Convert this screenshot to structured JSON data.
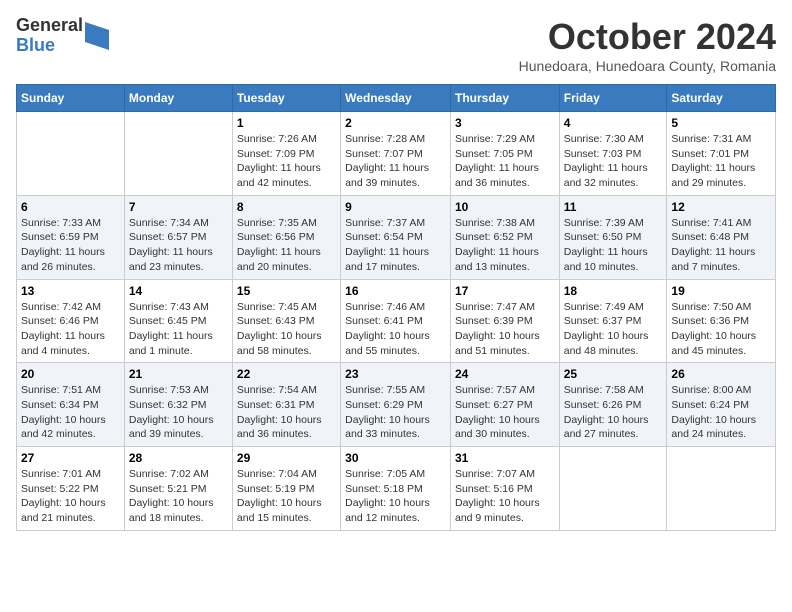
{
  "logo": {
    "line1": "General",
    "line2": "Blue"
  },
  "header": {
    "month": "October 2024",
    "location": "Hunedoara, Hunedoara County, Romania"
  },
  "weekdays": [
    "Sunday",
    "Monday",
    "Tuesday",
    "Wednesday",
    "Thursday",
    "Friday",
    "Saturday"
  ],
  "weeks": [
    [
      {
        "day": "",
        "info": ""
      },
      {
        "day": "",
        "info": ""
      },
      {
        "day": "1",
        "info": "Sunrise: 7:26 AM\nSunset: 7:09 PM\nDaylight: 11 hours and 42 minutes."
      },
      {
        "day": "2",
        "info": "Sunrise: 7:28 AM\nSunset: 7:07 PM\nDaylight: 11 hours and 39 minutes."
      },
      {
        "day": "3",
        "info": "Sunrise: 7:29 AM\nSunset: 7:05 PM\nDaylight: 11 hours and 36 minutes."
      },
      {
        "day": "4",
        "info": "Sunrise: 7:30 AM\nSunset: 7:03 PM\nDaylight: 11 hours and 32 minutes."
      },
      {
        "day": "5",
        "info": "Sunrise: 7:31 AM\nSunset: 7:01 PM\nDaylight: 11 hours and 29 minutes."
      }
    ],
    [
      {
        "day": "6",
        "info": "Sunrise: 7:33 AM\nSunset: 6:59 PM\nDaylight: 11 hours and 26 minutes."
      },
      {
        "day": "7",
        "info": "Sunrise: 7:34 AM\nSunset: 6:57 PM\nDaylight: 11 hours and 23 minutes."
      },
      {
        "day": "8",
        "info": "Sunrise: 7:35 AM\nSunset: 6:56 PM\nDaylight: 11 hours and 20 minutes."
      },
      {
        "day": "9",
        "info": "Sunrise: 7:37 AM\nSunset: 6:54 PM\nDaylight: 11 hours and 17 minutes."
      },
      {
        "day": "10",
        "info": "Sunrise: 7:38 AM\nSunset: 6:52 PM\nDaylight: 11 hours and 13 minutes."
      },
      {
        "day": "11",
        "info": "Sunrise: 7:39 AM\nSunset: 6:50 PM\nDaylight: 11 hours and 10 minutes."
      },
      {
        "day": "12",
        "info": "Sunrise: 7:41 AM\nSunset: 6:48 PM\nDaylight: 11 hours and 7 minutes."
      }
    ],
    [
      {
        "day": "13",
        "info": "Sunrise: 7:42 AM\nSunset: 6:46 PM\nDaylight: 11 hours and 4 minutes."
      },
      {
        "day": "14",
        "info": "Sunrise: 7:43 AM\nSunset: 6:45 PM\nDaylight: 11 hours and 1 minute."
      },
      {
        "day": "15",
        "info": "Sunrise: 7:45 AM\nSunset: 6:43 PM\nDaylight: 10 hours and 58 minutes."
      },
      {
        "day": "16",
        "info": "Sunrise: 7:46 AM\nSunset: 6:41 PM\nDaylight: 10 hours and 55 minutes."
      },
      {
        "day": "17",
        "info": "Sunrise: 7:47 AM\nSunset: 6:39 PM\nDaylight: 10 hours and 51 minutes."
      },
      {
        "day": "18",
        "info": "Sunrise: 7:49 AM\nSunset: 6:37 PM\nDaylight: 10 hours and 48 minutes."
      },
      {
        "day": "19",
        "info": "Sunrise: 7:50 AM\nSunset: 6:36 PM\nDaylight: 10 hours and 45 minutes."
      }
    ],
    [
      {
        "day": "20",
        "info": "Sunrise: 7:51 AM\nSunset: 6:34 PM\nDaylight: 10 hours and 42 minutes."
      },
      {
        "day": "21",
        "info": "Sunrise: 7:53 AM\nSunset: 6:32 PM\nDaylight: 10 hours and 39 minutes."
      },
      {
        "day": "22",
        "info": "Sunrise: 7:54 AM\nSunset: 6:31 PM\nDaylight: 10 hours and 36 minutes."
      },
      {
        "day": "23",
        "info": "Sunrise: 7:55 AM\nSunset: 6:29 PM\nDaylight: 10 hours and 33 minutes."
      },
      {
        "day": "24",
        "info": "Sunrise: 7:57 AM\nSunset: 6:27 PM\nDaylight: 10 hours and 30 minutes."
      },
      {
        "day": "25",
        "info": "Sunrise: 7:58 AM\nSunset: 6:26 PM\nDaylight: 10 hours and 27 minutes."
      },
      {
        "day": "26",
        "info": "Sunrise: 8:00 AM\nSunset: 6:24 PM\nDaylight: 10 hours and 24 minutes."
      }
    ],
    [
      {
        "day": "27",
        "info": "Sunrise: 7:01 AM\nSunset: 5:22 PM\nDaylight: 10 hours and 21 minutes."
      },
      {
        "day": "28",
        "info": "Sunrise: 7:02 AM\nSunset: 5:21 PM\nDaylight: 10 hours and 18 minutes."
      },
      {
        "day": "29",
        "info": "Sunrise: 7:04 AM\nSunset: 5:19 PM\nDaylight: 10 hours and 15 minutes."
      },
      {
        "day": "30",
        "info": "Sunrise: 7:05 AM\nSunset: 5:18 PM\nDaylight: 10 hours and 12 minutes."
      },
      {
        "day": "31",
        "info": "Sunrise: 7:07 AM\nSunset: 5:16 PM\nDaylight: 10 hours and 9 minutes."
      },
      {
        "day": "",
        "info": ""
      },
      {
        "day": "",
        "info": ""
      }
    ]
  ]
}
